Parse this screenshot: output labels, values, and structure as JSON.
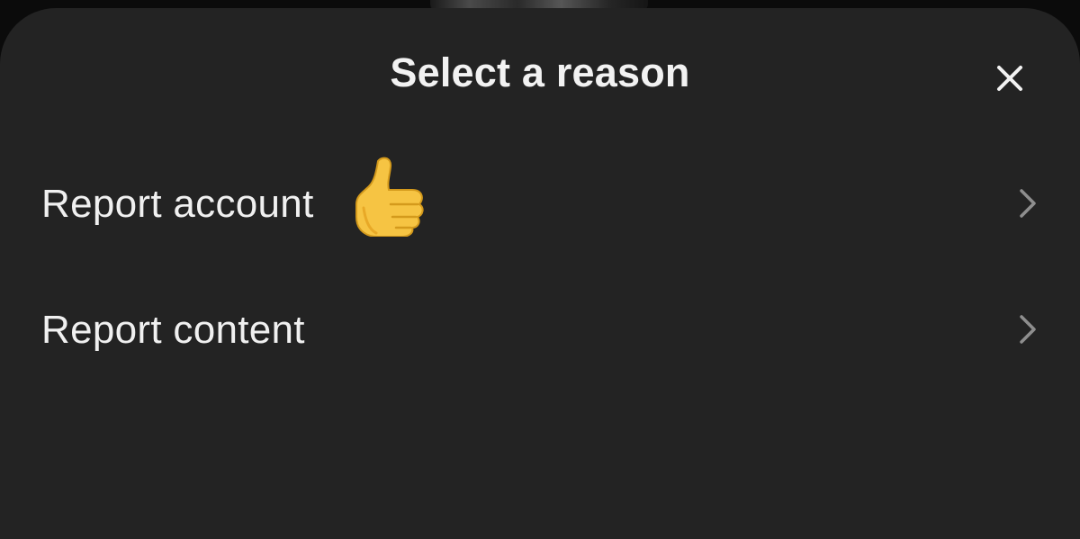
{
  "sheet": {
    "title": "Select a reason",
    "close_icon": "close-icon"
  },
  "menu": {
    "items": [
      {
        "label": "Report account",
        "icon": "thumbs-up-emoji",
        "chevron": "chevron-right-icon"
      },
      {
        "label": "Report content",
        "chevron": "chevron-right-icon"
      }
    ]
  },
  "colors": {
    "sheet_background": "#232323",
    "text": "#f0f0f0",
    "chevron": "#8e8e8e",
    "emoji": "#f6c443"
  }
}
